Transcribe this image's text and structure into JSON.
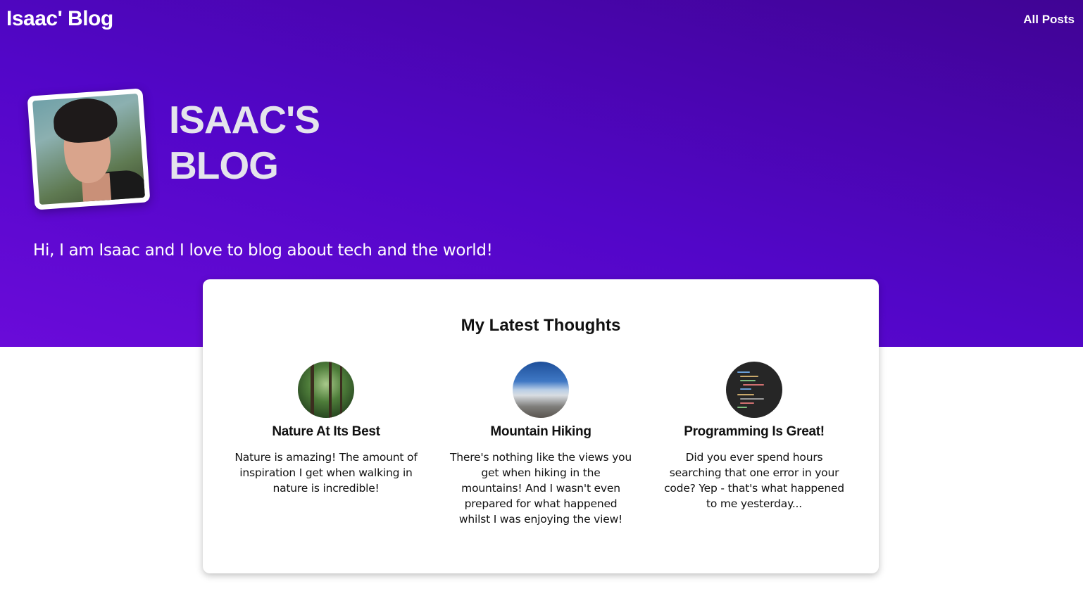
{
  "header": {
    "site_title": "Isaac' Blog",
    "nav": {
      "all_posts_label": "All Posts"
    }
  },
  "hero": {
    "heading_line1": "ISAAC'S",
    "heading_line2": "BLOG",
    "tagline": "Hi, I am Isaac and I love to blog about tech and the world!",
    "gradient_colors": [
      "#6a0bd9",
      "#400494"
    ]
  },
  "latest": {
    "title": "My Latest Thoughts",
    "posts": [
      {
        "title": "Nature At Its Best",
        "excerpt": "Nature is amazing! The amount of inspiration I get when walking in nature is incredible!",
        "thumbnail_icon": "forest-image"
      },
      {
        "title": "Mountain Hiking",
        "excerpt": "There's nothing like the views you get when hiking in the mountains! And I wasn't even prepared for what happened whilst I was enjoying the view!",
        "thumbnail_icon": "mountain-image"
      },
      {
        "title": "Programming Is Great!",
        "excerpt": "Did you ever spend hours searching that one error in your code? Yep - that's what happened to me yesterday...",
        "thumbnail_icon": "code-image"
      }
    ]
  }
}
